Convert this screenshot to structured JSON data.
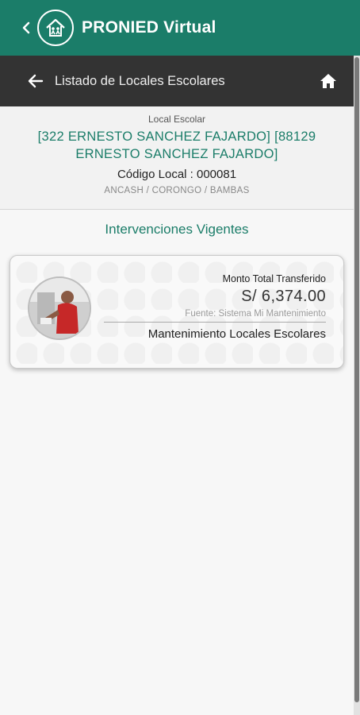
{
  "app": {
    "title": "PRONIED Virtual"
  },
  "nav": {
    "title": "Listado de Locales Escolares"
  },
  "school": {
    "caption": "Local Escolar",
    "name": "[322 ERNESTO SANCHEZ FAJARDO] [88129 ERNESTO SANCHEZ FAJARDO]",
    "code": "Código Local : 000081",
    "location": "ANCASH / CORONGO / BAMBAS"
  },
  "section": {
    "title": "Intervenciones Vigentes"
  },
  "intervention": {
    "amount_label": "Monto Total Transferido",
    "amount": "S/ 6,374.00",
    "source": "Fuente: Sistema Mi Mantenimiento",
    "program": "Mantenimiento Locales Escolares"
  },
  "colors": {
    "brand_green": "#1b7d69",
    "navbar": "#333333"
  },
  "icons": {
    "back": "chevron-left-icon",
    "logo": "school-home-logo-icon",
    "nav_back": "arrow-left-icon",
    "home": "home-icon"
  }
}
